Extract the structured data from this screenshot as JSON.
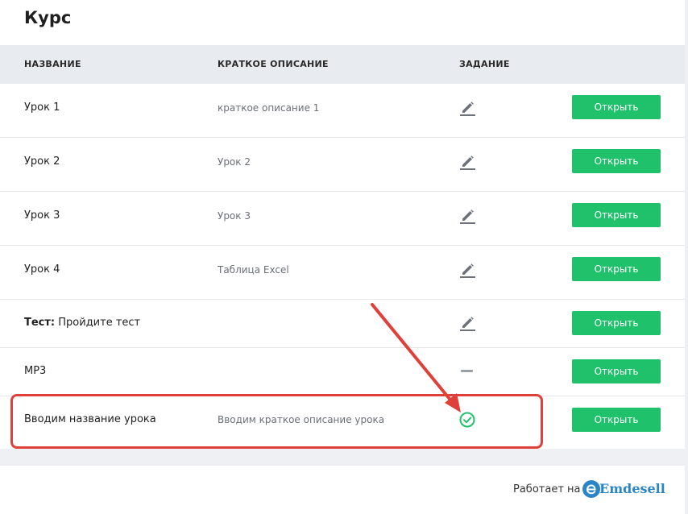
{
  "page": {
    "title": "Курс"
  },
  "table": {
    "headers": {
      "name": "НАЗВАНИЕ",
      "description": "КРАТКОЕ ОПИСАНИЕ",
      "task": "ЗАДАНИЕ"
    },
    "rows": [
      {
        "name": "Урок 1",
        "description": "краткое описание 1",
        "task_icon": "pencil-icon",
        "button": "Открыть"
      },
      {
        "name": "Урок 2",
        "description": "Урок 2",
        "task_icon": "pencil-icon",
        "button": "Открыть"
      },
      {
        "name": "Урок 3",
        "description": "Урок 3",
        "task_icon": "pencil-icon",
        "button": "Открыть"
      },
      {
        "name": "Урок 4",
        "description": "Таблица Excel",
        "task_icon": "pencil-icon",
        "button": "Открыть"
      },
      {
        "name_prefix": "Тест:",
        "name": "Пройдите тест",
        "description": "",
        "task_icon": "pencil-icon",
        "button": "Открыть"
      },
      {
        "name": "MP3",
        "description": "",
        "task_icon": "dash-icon",
        "button": "Открыть"
      },
      {
        "name": "Вводим название урока",
        "description": "Вводим краткое описание урока",
        "task_icon": "check-circle-icon",
        "button": "Открыть"
      }
    ]
  },
  "footer": {
    "powered_by": "Работает на",
    "brand": "Emdesell"
  },
  "colors": {
    "accent": "#1fc16b",
    "annotation": "#e0403a",
    "brand": "#2a84c8"
  }
}
